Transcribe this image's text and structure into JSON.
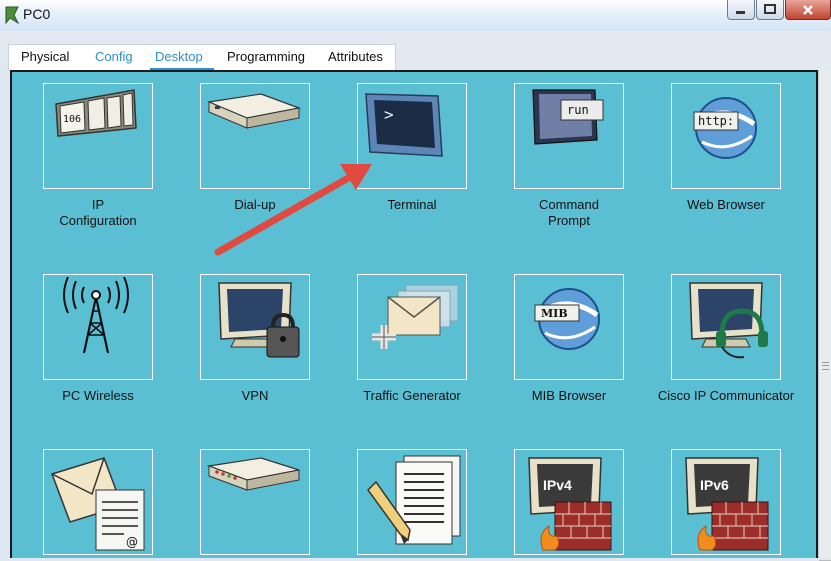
{
  "window": {
    "title": "PC0"
  },
  "tabs": [
    "Physical",
    "Config",
    "Desktop",
    "Programming",
    "Attributes"
  ],
  "active_tab": "Desktop",
  "apps": [
    {
      "label": "IP\nConfiguration",
      "icon": "ip-configuration-icon",
      "badge": "106"
    },
    {
      "label": "Dial-up",
      "icon": "modem-icon"
    },
    {
      "label": "Terminal",
      "icon": "terminal-icon",
      "prompt": ">"
    },
    {
      "label": "Command\nPrompt",
      "icon": "command-prompt-icon",
      "badge": "run"
    },
    {
      "label": "Web Browser",
      "icon": "web-browser-icon",
      "badge": "http:"
    },
    {
      "label": "PC Wireless",
      "icon": "wireless-tower-icon"
    },
    {
      "label": "VPN",
      "icon": "vpn-lock-icon"
    },
    {
      "label": "Traffic Generator",
      "icon": "traffic-generator-icon"
    },
    {
      "label": "MIB Browser",
      "icon": "mib-browser-icon",
      "badge": "MIB"
    },
    {
      "label": "Cisco IP Communicator",
      "icon": "ip-communicator-headset-icon"
    },
    {
      "label": "",
      "icon": "email-icon",
      "badge": "@"
    },
    {
      "label": "",
      "icon": "pppoe-dialer-icon"
    },
    {
      "label": "",
      "icon": "text-editor-icon"
    },
    {
      "label": "",
      "icon": "ipv4-firewall-icon",
      "badge": "IPv4"
    },
    {
      "label": "",
      "icon": "ipv6-firewall-icon",
      "badge": "IPv6"
    }
  ],
  "colors": {
    "desktop_bg": "#5bbfd3",
    "accent": "#2f8fd0",
    "annotation_arrow": "#e04a3f"
  }
}
